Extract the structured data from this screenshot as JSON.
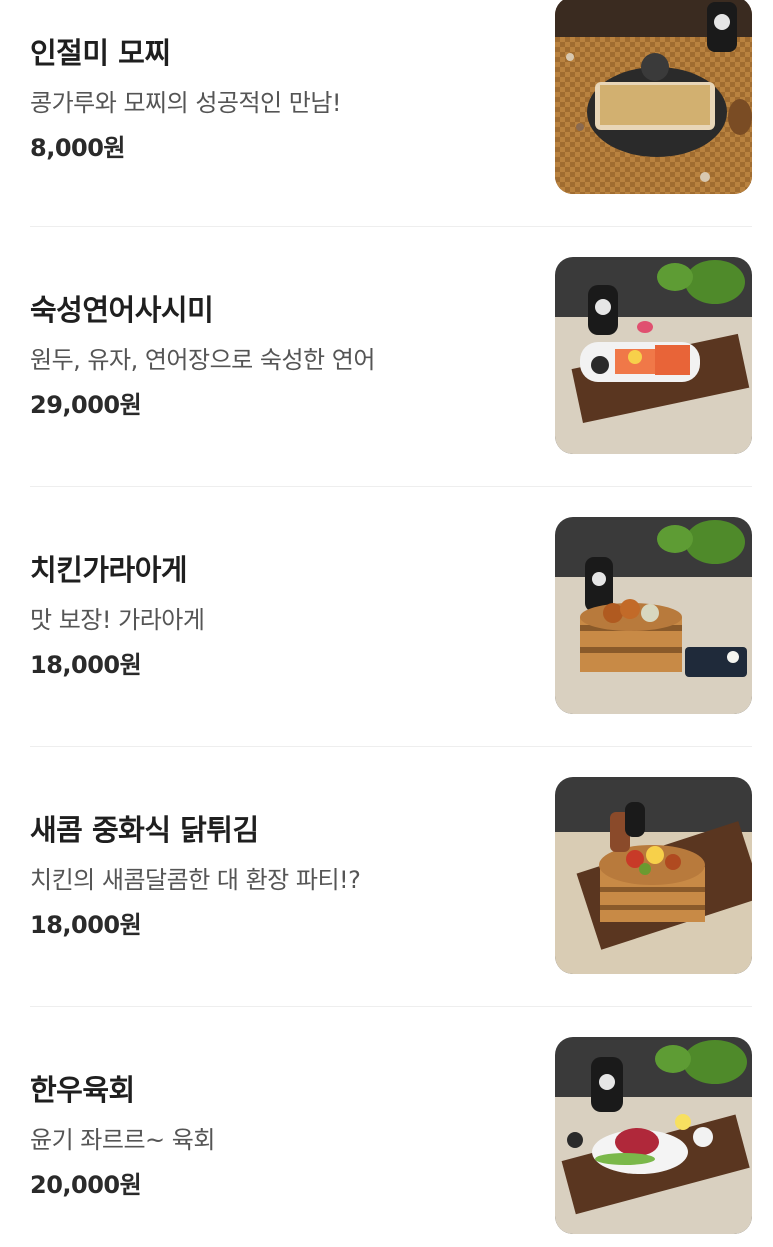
{
  "menu": {
    "items": [
      {
        "name": "인절미 모찌",
        "description": "콩가루와 모찌의 성공적인 만남!",
        "price": "8,000원",
        "image_icon": "injeolmi-mochi-photo"
      },
      {
        "name": "숙성연어사시미",
        "description": "원두, 유자, 연어장으로 숙성한 연어",
        "price": "29,000원",
        "image_icon": "salmon-sashimi-photo"
      },
      {
        "name": "치킨가라아게",
        "description": "맛 보장! 가라아게",
        "price": "18,000원",
        "image_icon": "chicken-karaage-photo"
      },
      {
        "name": "새콤 중화식 닭튀김",
        "description": "치킨의 새콤달콤한 대 환장 파티!?",
        "price": "18,000원",
        "image_icon": "sweet-sour-chicken-photo"
      },
      {
        "name": "한우육회",
        "description": "윤기 좌르르~ 육회",
        "price": "20,000원",
        "image_icon": "hanwoo-yukhoe-photo"
      }
    ]
  }
}
